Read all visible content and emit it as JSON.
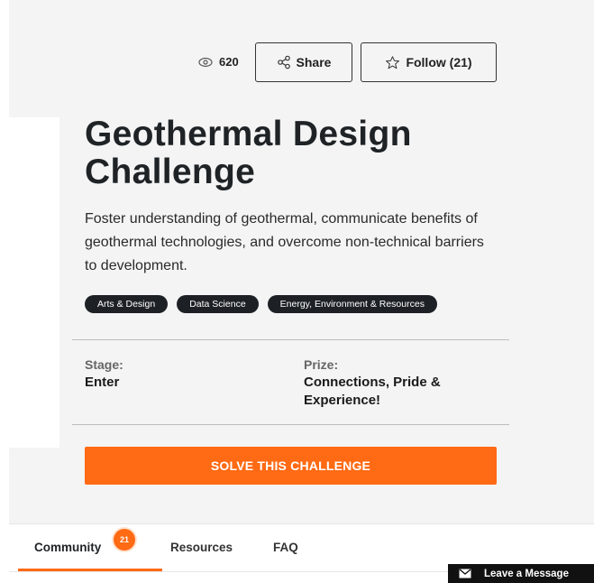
{
  "stats": {
    "views": "620"
  },
  "actions": {
    "share_label": "Share",
    "follow_label": "Follow (21)"
  },
  "challenge": {
    "title": "Geothermal Design Challenge",
    "description": "Foster understanding of geothermal, communicate benefits of geothermal technologies, and overcome non-technical barriers to development.",
    "tags": [
      "Arts & Design",
      "Data Science",
      "Energy, Environment & Resources"
    ],
    "stage_label": "Stage:",
    "stage_value": "Enter",
    "prize_label": "Prize:",
    "prize_value": "Connections, Pride & Experience!",
    "cta_label": "SOLVE THIS CHALLENGE"
  },
  "tabs": [
    {
      "label": "Community",
      "badge": "21"
    },
    {
      "label": "Resources"
    },
    {
      "label": "FAQ"
    }
  ],
  "chat": {
    "label": "Leave a Message"
  },
  "colors": {
    "accent": "#ff6a14",
    "tag_bg": "#1d2126",
    "panel_bg": "#f4f4f4"
  }
}
